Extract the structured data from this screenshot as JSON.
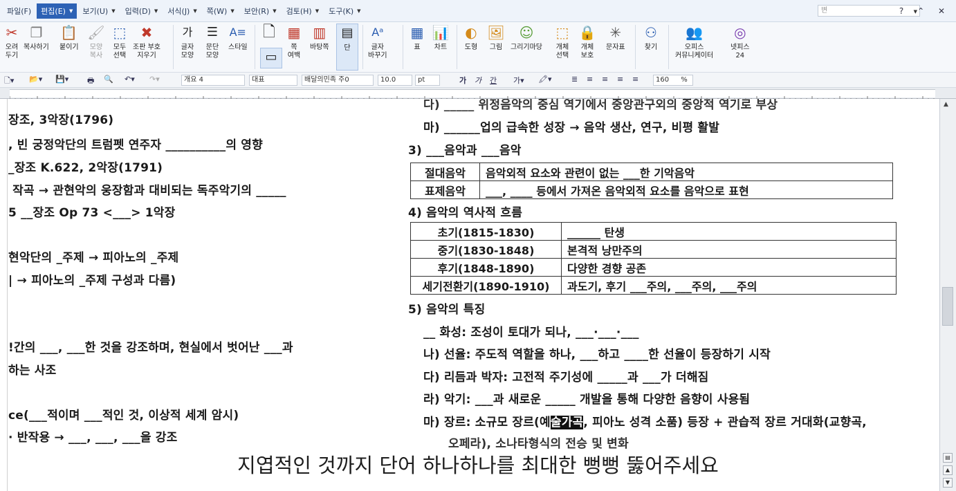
{
  "menus": [
    {
      "label": "파일(F)",
      "arrow": false,
      "active": false
    },
    {
      "label": "편집(E)",
      "arrow": true,
      "active": true
    },
    {
      "label": "보기(U)",
      "arrow": true,
      "active": false
    },
    {
      "label": "입력(D)",
      "arrow": true,
      "active": false
    },
    {
      "label": "서식(J)",
      "arrow": true,
      "active": false
    },
    {
      "label": "쪽(W)",
      "arrow": true,
      "active": false
    },
    {
      "label": "보안(R)",
      "arrow": true,
      "active": false
    },
    {
      "label": "검토(H)",
      "arrow": true,
      "active": false
    },
    {
      "label": "도구(K)",
      "arrow": true,
      "active": false
    }
  ],
  "menu_search_text": "변",
  "ribbon": {
    "cut": "오려\n두기",
    "copy": "복사하기",
    "paste": "붙이기",
    "format_copy": "모양\n복사",
    "select_all": "모두\n선택",
    "clear_format": "조판 부호\n지우기",
    "char_shape": "글자\n모양",
    "para_shape": "문단\n모양",
    "style": "스타일",
    "page_margin": "쪽\n여백",
    "background": "바탕쪽",
    "columns": "단",
    "char_convert": "글자\n바꾸기",
    "table": "표",
    "chart": "차트",
    "shape": "도형",
    "picture": "그림",
    "drawing": "그리기마당",
    "obj_select": "개체\n선택",
    "obj_protect": "개체\n보호",
    "symbol": "문자표",
    "find": "찾기",
    "office_comm": "오피스\n커뮤니케이터",
    "netfice": "넷피스\n24"
  },
  "format_bar": {
    "style_box": "개요 4",
    "font_type": "대표",
    "font_name": "배달의민족 주0",
    "font_size": "10.0",
    "font_unit": "pt",
    "zoom": "160",
    "zoom_unit": "%"
  },
  "left_column": [
    "장조, 3악장(1796)",
    ", 빈 궁정악단의 트럼펫 연주자 __________의 영향",
    "_장조 K.622, 2악장(1791)",
    " 작곡 → 관현악의 웅장함과 대비되는 독주악기의 _____",
    "5 __장조 Op 73 <___> 1악장",
    "현악단의 _주제 → 피아노의 _주제",
    "| → 피아노의 _주제 구성과 다름)",
    "!간의 ___, ___한 것을 강조하며, 현실에서 벗어난 ___과",
    "하는 사조",
    "ce(___적이며 ___적인 것, 이상적 세계 암시)",
    "· 반작용 → ___, ___, ___을 강조"
  ],
  "right_column": {
    "line_top_partial": "다) _____ 위정음악의 중심 역기에서 중앙관구외의 중앙적 역기로 부상",
    "line_ma1": "마) ______업의 급속한 성장 → 음악 생산, 연구, 비평 활발",
    "heading3": "3) ___음악과 ___음악",
    "table1": [
      [
        "절대음악",
        "음악외적 요소와 관련이 없는 ___한 기악음악"
      ],
      [
        "표제음악",
        "___, ____ 등에서 가져온 음악외적 요소를 음악으로 표현"
      ]
    ],
    "heading4": "4) 음악의 역사적 흐름",
    "table2": [
      [
        "초기(1815-1830)",
        "______ 탄생"
      ],
      [
        "중기(1830-1848)",
        "본격적 낭만주의"
      ],
      [
        "후기(1848-1890)",
        "다양한 경향 공존"
      ],
      [
        "세기전환기(1890-1910)",
        "과도기, 후기 ___주의, ___주의, ___주의"
      ]
    ],
    "heading5": "5) 음악의 특징",
    "line_ga": "__ 화성: 조성이 토대가 되나, ___·___·___",
    "line_na": "나) 선율: 주도적 역할을 하나, ___하고 ____한 선율이 등장하기 시작",
    "line_da": "다) 리듬과 박자: 고전적 주기성에 _____과 ___가 더해짐",
    "line_ra": "라) 악기: ___과 새로운 _____ 개발을 통해 다양한 음향이 사용됨",
    "line_ma2_pre": "마) 장르: 소규모 장르(예",
    "line_ma2_hl": "술가곡",
    "line_ma2_post": ", 피아노 성격 소품) 등장 + 관습적 장르 거대화(교향곡,",
    "line_bottom_partial": "오페라), 소나타형식의 전승 및 변화"
  },
  "subtitle": "지엽적인 것까지 단어 하나하나를 최대한 뻥뻥 뚫어주세요"
}
